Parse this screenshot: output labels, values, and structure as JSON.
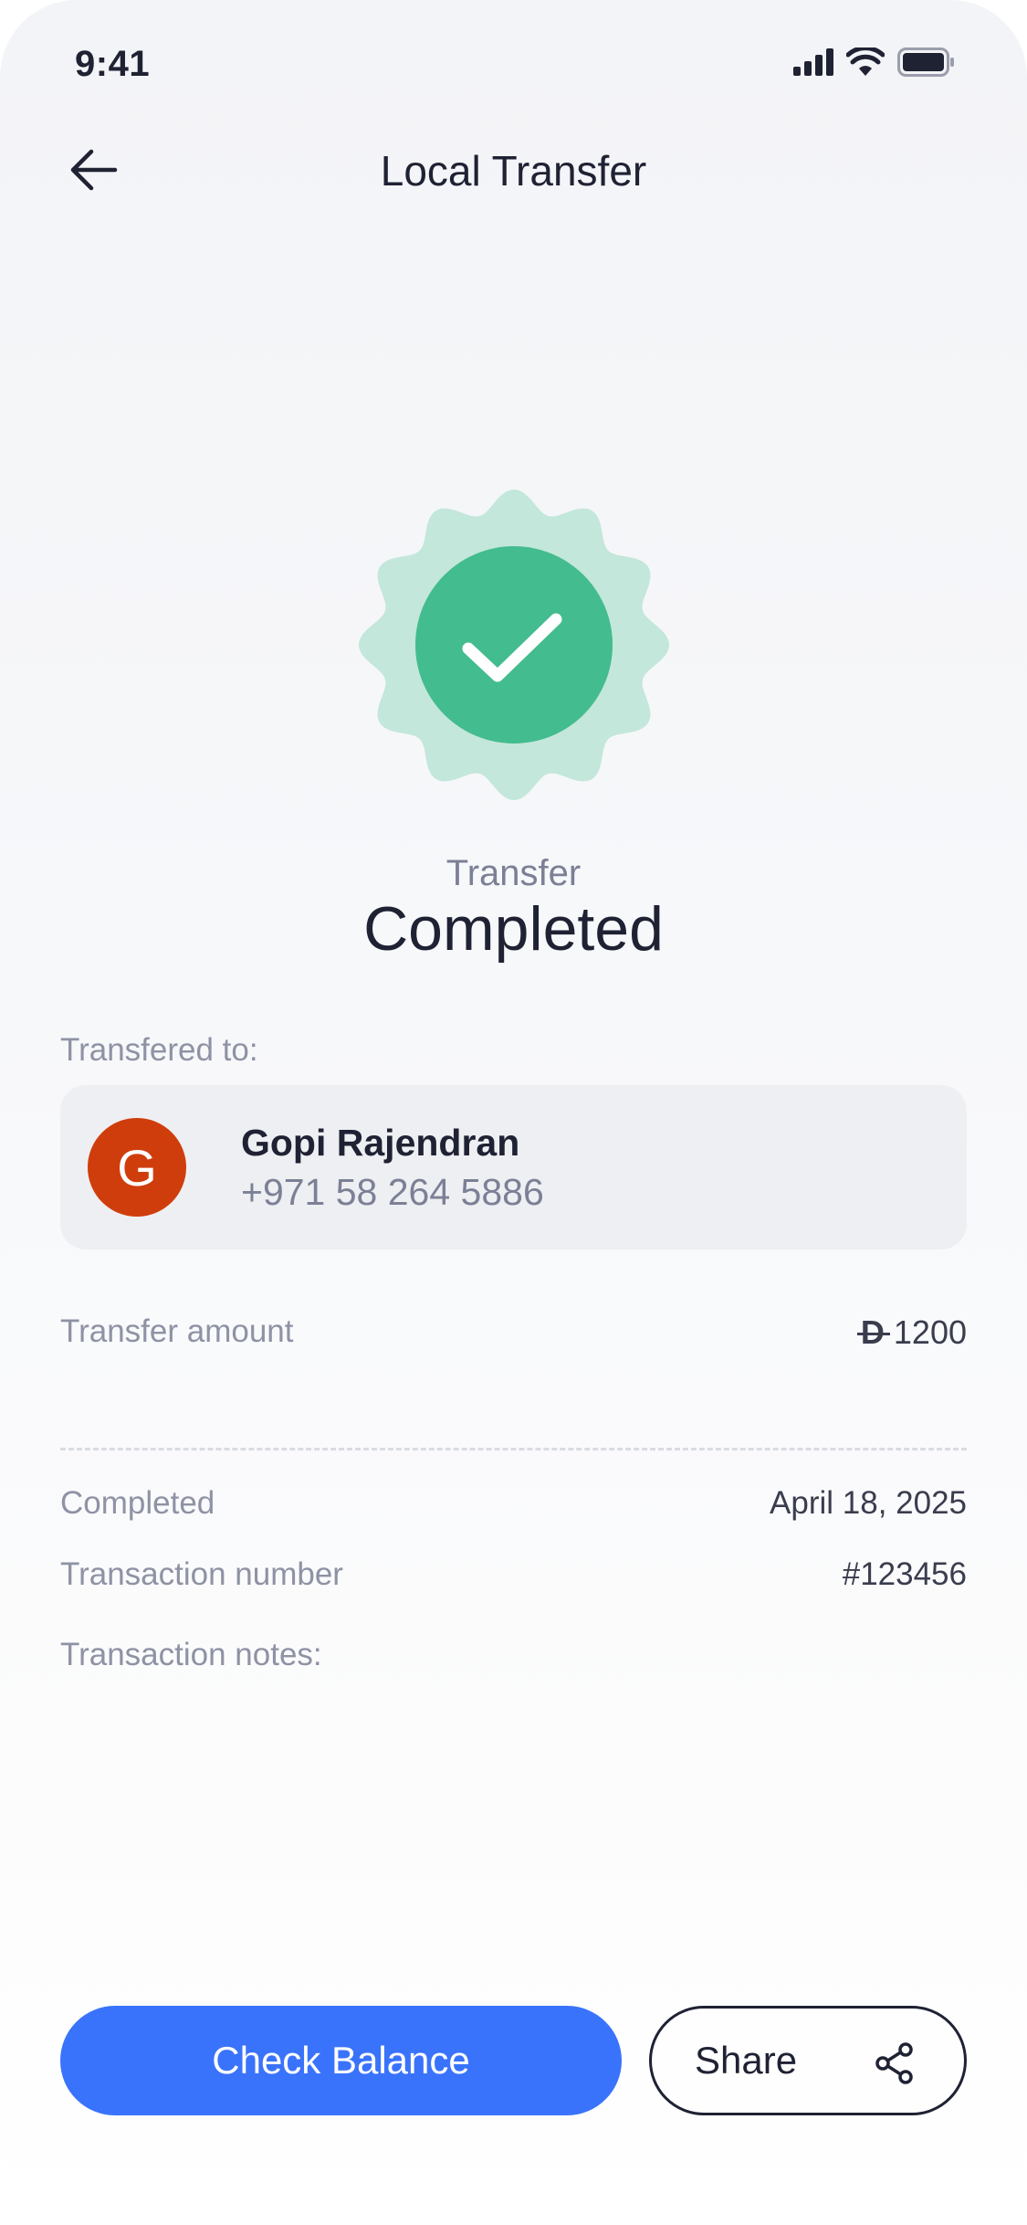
{
  "status_bar": {
    "time": "9:41",
    "icons": [
      "cellular-signal-icon",
      "wifi-icon",
      "battery-icon"
    ]
  },
  "nav": {
    "back_icon": "arrow-left-icon",
    "title": "Local Transfer"
  },
  "result": {
    "icon": "check-badge-icon",
    "label": "Transfer",
    "title": "Completed",
    "colors": {
      "badge_outer": "#c3e7da",
      "badge_inner": "#43bc8f",
      "check": "#ffffff"
    }
  },
  "recipient": {
    "section_label": "Transfered to:",
    "avatar_initial": "G",
    "avatar_color": "#d03d0c",
    "name": "Gopi Rajendran",
    "phone": "+971 58 264 5886"
  },
  "details": {
    "amount_label": "Transfer amount",
    "currency_symbol": "D",
    "amount_value": "1200",
    "date_label": "Completed",
    "date_value": "April 18, 2025",
    "txn_label": "Transaction number",
    "txn_value": "#123456",
    "notes_label": "Transaction notes:"
  },
  "actions": {
    "primary_label": "Check Balance",
    "secondary_label": "Share",
    "secondary_icon": "share-icon",
    "accent": "#3a73fb"
  }
}
